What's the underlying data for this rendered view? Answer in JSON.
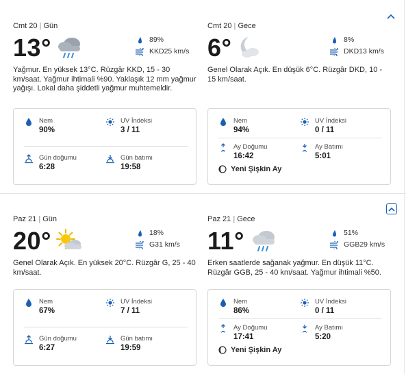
{
  "days": [
    {
      "day": {
        "date": "Cmt 20",
        "period": "Gün",
        "temp": "13°",
        "icon": "rain-cloud-icon",
        "precip": "89%",
        "wind": "KKD25 km/s",
        "description": "Yağmur. En yüksek 13°C. Rüzgâr KKD, 15 - 30 km/saat. Yağmur ihtimali %90. Yaklaşık 12 mm yağmur yağışı. Lokal daha şiddetli yağmur muhtemeldir.",
        "details": {
          "humidity_label": "Nem",
          "humidity": "90%",
          "uv_label": "UV İndeksi",
          "uv": "3 / 11",
          "sunrise_label": "Gün doğumu",
          "sunrise": "6:28",
          "sunset_label": "Gün batımı",
          "sunset": "19:58"
        }
      },
      "night": {
        "date": "Cmt 20",
        "period": "Gece",
        "temp": "6°",
        "icon": "moon-cloud-icon",
        "precip": "8%",
        "wind": "DKD13 km/s",
        "description": "Genel Olarak Açık. En düşük 6°C. Rüzgâr DKD, 10 - 15 km/saat.",
        "details": {
          "humidity_label": "Nem",
          "humidity": "94%",
          "uv_label": "UV İndeksi",
          "uv": "0 / 11",
          "moonrise_label": "Ay Doğumu",
          "moonrise": "16:42",
          "moonset_label": "Ay Batımı",
          "moonset": "5:01",
          "moon_phase": "Yeni Şişkin Ay"
        }
      }
    },
    {
      "day": {
        "date": "Paz 21",
        "period": "Gün",
        "temp": "20°",
        "icon": "sun-cloud-icon",
        "precip": "18%",
        "wind": "G31 km/s",
        "description": "Genel Olarak Açık. En yüksek 20°C. Rüzgâr G, 25 - 40 km/saat.",
        "details": {
          "humidity_label": "Nem",
          "humidity": "67%",
          "uv_label": "UV İndeksi",
          "uv": "7 / 11",
          "sunrise_label": "Gün doğumu",
          "sunrise": "6:27",
          "sunset_label": "Gün batımı",
          "sunset": "19:59"
        }
      },
      "night": {
        "date": "Paz 21",
        "period": "Gece",
        "temp": "11°",
        "icon": "rain-cloud-icon",
        "precip": "51%",
        "wind": "GGB29 km/s",
        "description": "Erken saatlerde sağanak yağmur. En düşük 11°C. Rüzgâr GGB, 25 - 40 km/saat. Yağmur ihtimali %50.",
        "details": {
          "humidity_label": "Nem",
          "humidity": "86%",
          "uv_label": "UV İndeksi",
          "uv": "0 / 11",
          "moonrise_label": "Ay Doğumu",
          "moonrise": "17:41",
          "moonset_label": "Ay Batımı",
          "moonset": "5:20",
          "moon_phase": "Yeni Şişkin Ay"
        }
      }
    }
  ],
  "colors": {
    "accent": "#1a5fb4",
    "text": "#1b1b1b",
    "border": "#d6d6d6"
  },
  "controls": {
    "collapse_icon": "chevron-up-icon",
    "expand_icon": "expand-toggle-icon"
  }
}
